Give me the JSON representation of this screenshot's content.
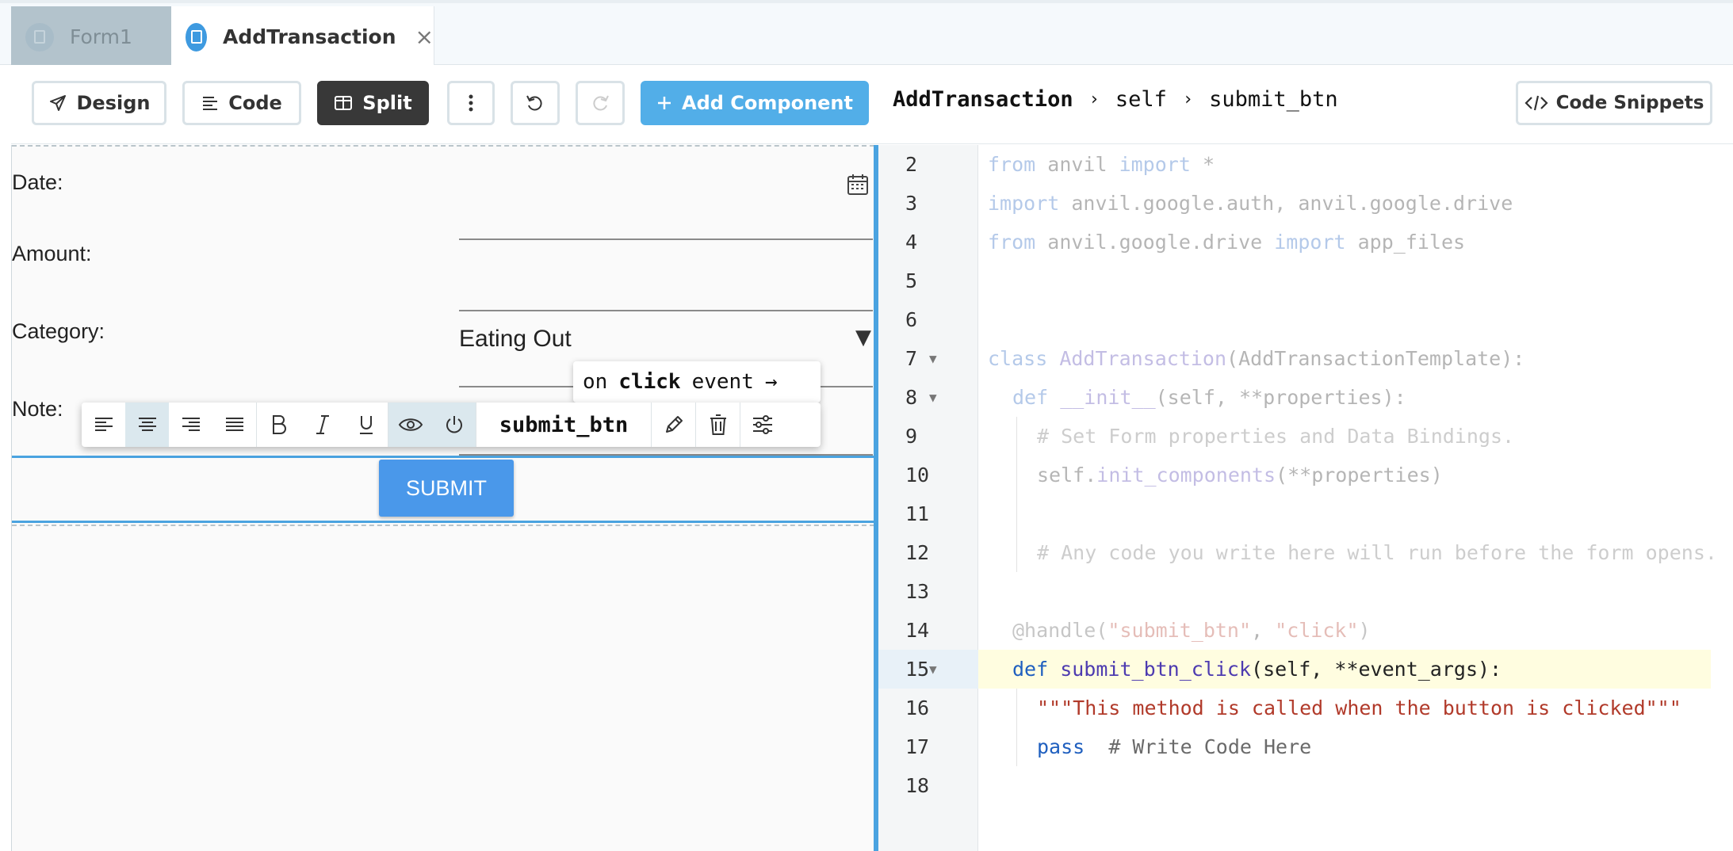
{
  "tabs": [
    {
      "label": "Form1",
      "active": false
    },
    {
      "label": "AddTransaction",
      "active": true,
      "close": "×"
    }
  ],
  "toolbar": {
    "design_label": "Design",
    "code_label": "Code",
    "split_label": "Split",
    "add_component_label": "Add Component",
    "code_snippets_label": "Code Snippets"
  },
  "breadcrumb": [
    "AddTransaction",
    "self",
    "submit_btn"
  ],
  "breadcrumb_sep": "›",
  "form": {
    "date_label": "Date:",
    "amount_label": "Amount:",
    "category_label": "Category:",
    "category_value": "Eating Out",
    "category_arrow": "▼",
    "note_label": "Note:",
    "submit_label": "SUBMIT"
  },
  "event_tip": {
    "prefix": "on",
    "event": "click",
    "suffix": "event",
    "arrow": "→"
  },
  "component_toolbar": {
    "component_name": "submit_btn"
  },
  "editor": {
    "lines": [
      {
        "n": "2",
        "dim": true
      },
      {
        "n": "3",
        "dim": true
      },
      {
        "n": "4",
        "dim": true
      },
      {
        "n": "5",
        "dim": true
      },
      {
        "n": "6",
        "dim": true
      },
      {
        "n": "7",
        "dim": true
      },
      {
        "n": "8",
        "dim": true
      },
      {
        "n": "9",
        "dim": true
      },
      {
        "n": "10",
        "dim": true
      },
      {
        "n": "11",
        "dim": true
      },
      {
        "n": "12",
        "dim": true
      },
      {
        "n": "13",
        "dim": true
      },
      {
        "n": "14",
        "dim": true
      },
      {
        "n": "15",
        "dim": false
      },
      {
        "n": "16",
        "dim": false
      },
      {
        "n": "17",
        "dim": false
      },
      {
        "n": "18",
        "dim": false
      }
    ],
    "code": {
      "l2a": "from",
      "l2b": " anvil ",
      "l2c": "import",
      "l2d": " *",
      "l3a": "import",
      "l3b": " anvil.google.auth, anvil.google.drive",
      "l4a": "from",
      "l4b": " anvil.google.drive ",
      "l4c": "import",
      "l4d": " app_files",
      "l7a": "class",
      "l7b": " AddTransaction",
      "l7c": "(AddTransactionTemplate):",
      "l8a": "def",
      "l8b": " __init__",
      "l8c": "(self, **properties):",
      "l9": "# Set Form properties and Data Bindings.",
      "l10a": "self.",
      "l10b": "init_components",
      "l10c": "(**properties)",
      "l12": "# Any code you write here will run before the form opens.",
      "l14a": "@handle(",
      "l14b": "\"submit_btn\"",
      "l14c": ", ",
      "l14d": "\"click\"",
      "l14e": ")",
      "l15a": "def",
      "l15b": " submit_btn_click",
      "l15c": "(self, **event_args):",
      "l16": "\"\"\"This method is called when the button is clicked\"\"\"",
      "l17a": "pass",
      "l17b": "  # Write Code Here"
    }
  },
  "colors": {
    "accent": "#4aa3e0",
    "add_component": "#52aee8",
    "split_active": "#383838",
    "submit_button": "#4a98ea"
  }
}
